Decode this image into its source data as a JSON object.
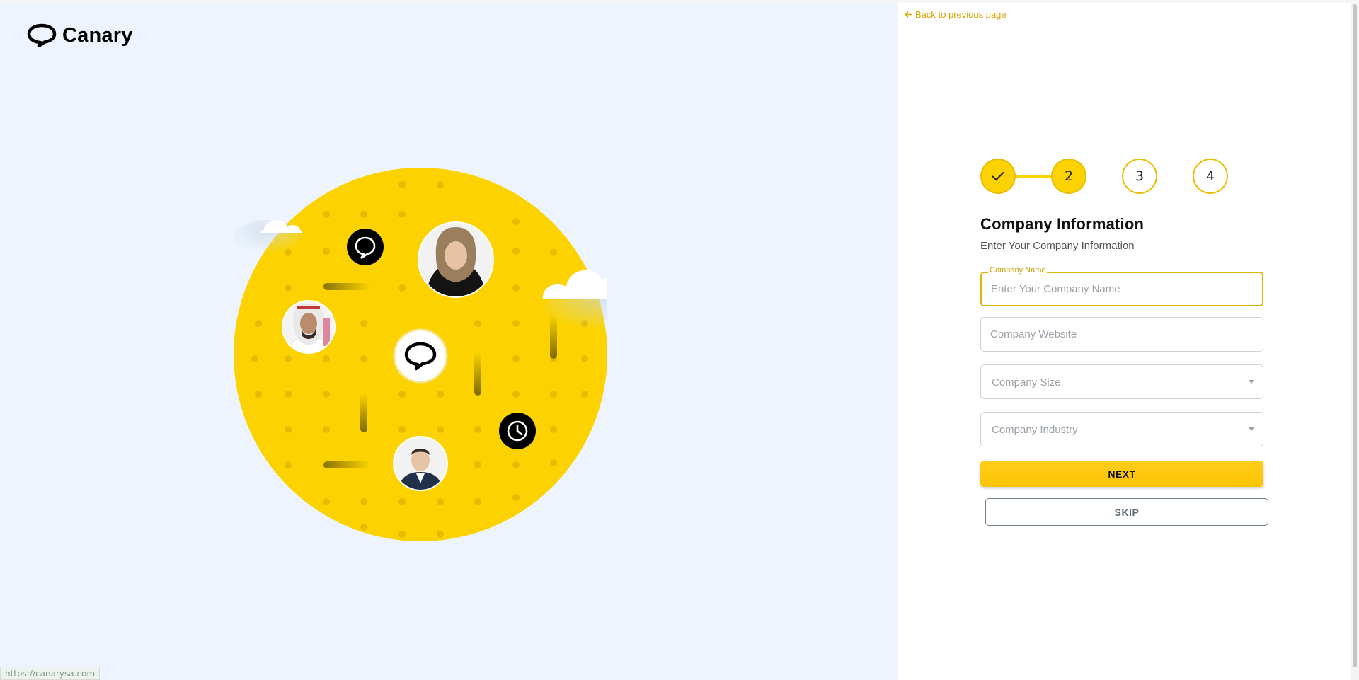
{
  "app": {
    "brand": "Canary",
    "status_url": "https://canarysa.com"
  },
  "nav": {
    "back_label": "Back to previous page"
  },
  "stepper": {
    "steps": [
      "",
      "2",
      "3",
      "4"
    ],
    "completed_count": 1,
    "current_step": 2
  },
  "form": {
    "title": "Company Information",
    "subtitle": "Enter Your Company Information",
    "company_name": {
      "label": "Company Name",
      "placeholder": "Enter Your Company Name",
      "value": ""
    },
    "company_website": {
      "placeholder": "Company Website",
      "value": ""
    },
    "company_size": {
      "placeholder": "Company Size"
    },
    "company_industry": {
      "placeholder": "Company Industry"
    },
    "next_label": "NEXT",
    "skip_label": "SKIP"
  },
  "colors": {
    "accent": "#fcd300",
    "accent_dark": "#e8bd00",
    "left_background": "#edf4fd",
    "link": "#d6a600"
  },
  "icons": {
    "logo": "speech-bubble-icon",
    "back": "arrow-left-icon",
    "check": "check-icon",
    "dropdown": "chevron-down-icon",
    "chat": "chat-bubble-icon",
    "clock": "clock-icon"
  }
}
